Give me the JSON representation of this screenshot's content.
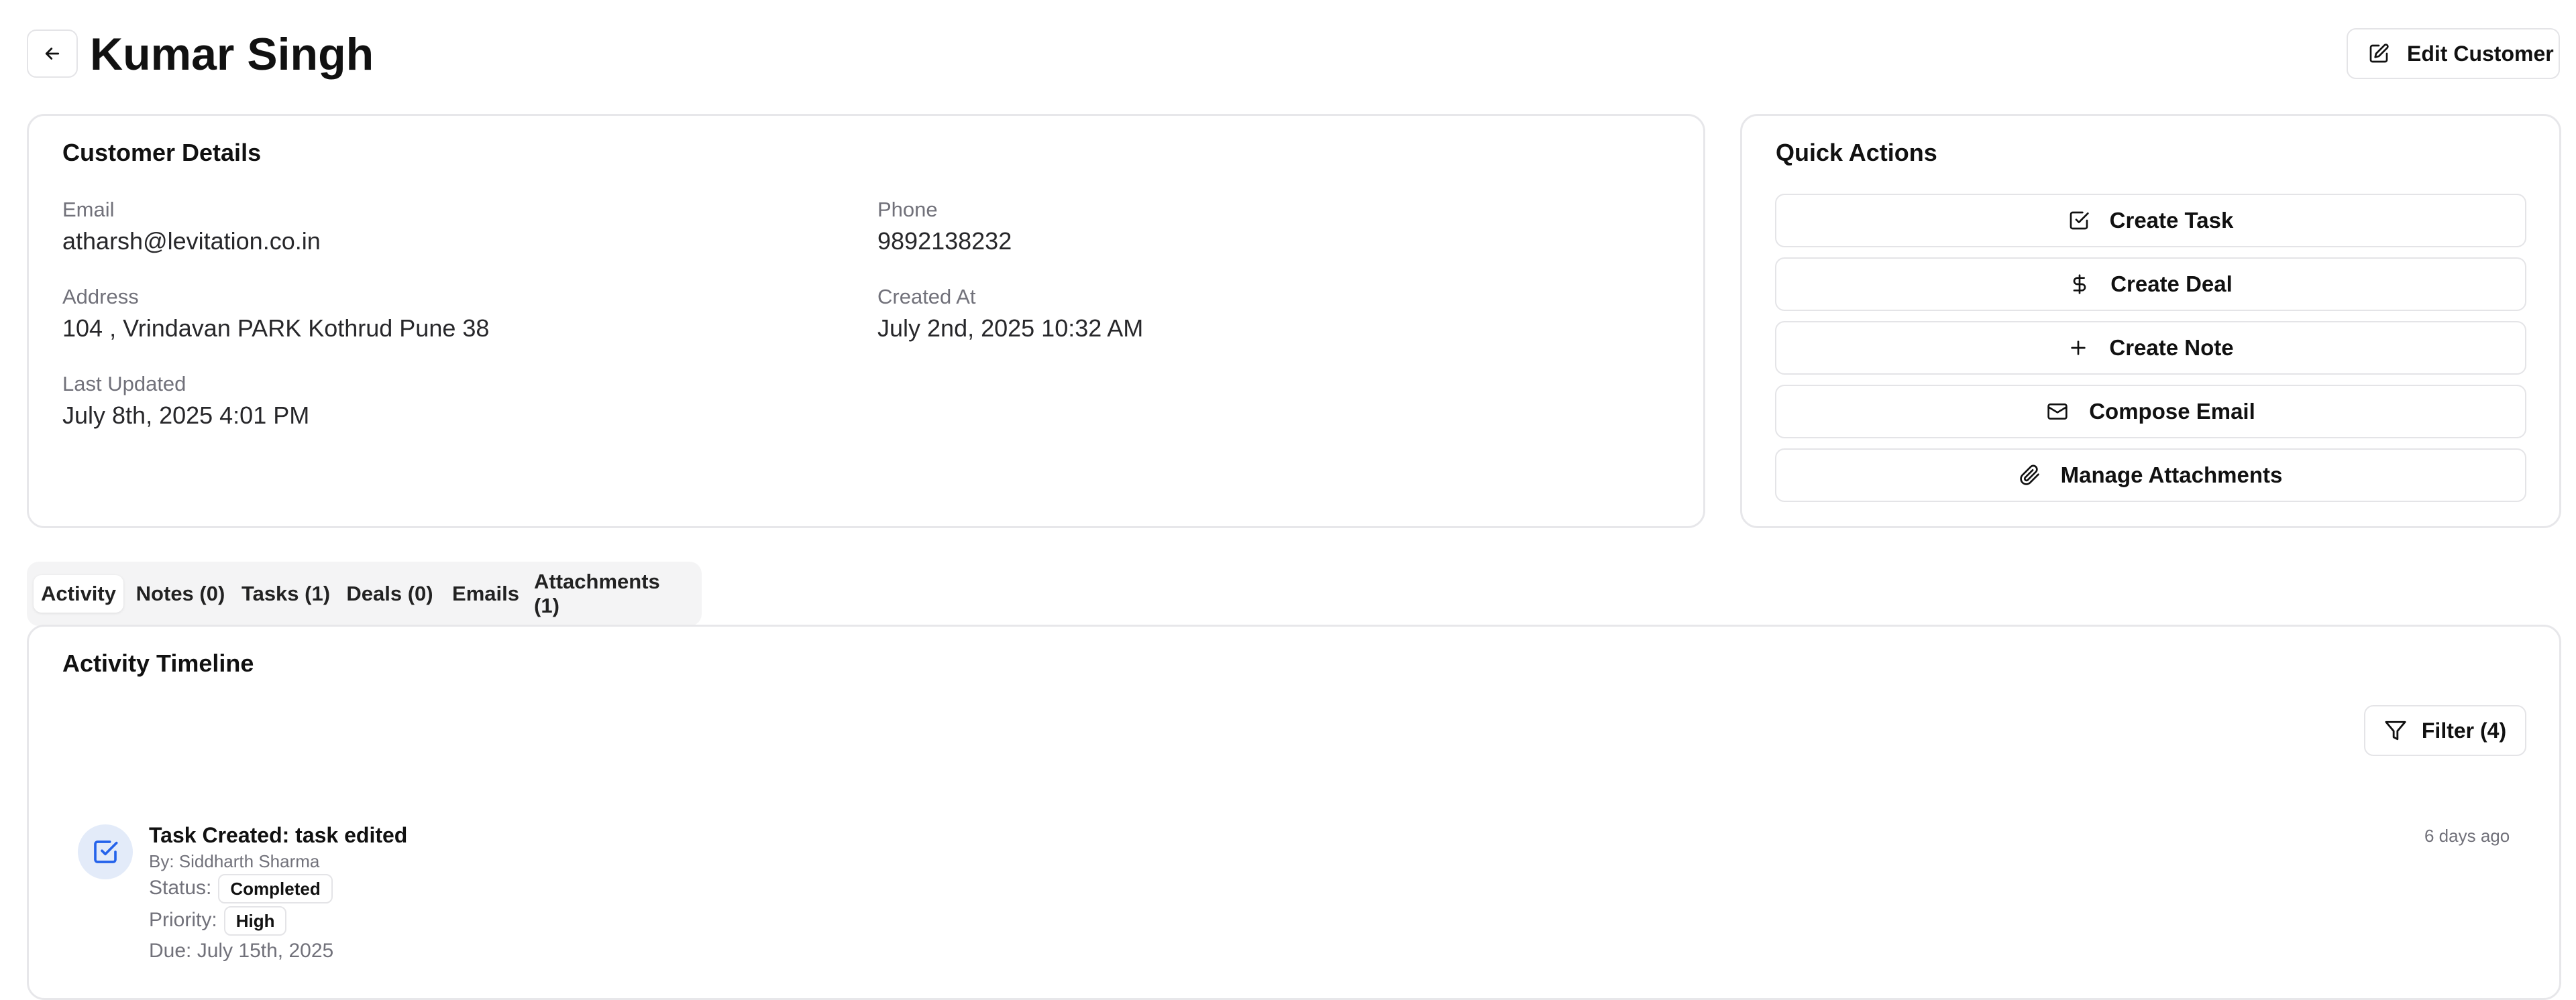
{
  "header": {
    "title": "Kumar Singh",
    "edit_label": "Edit Customer"
  },
  "details": {
    "title": "Customer Details",
    "email_label": "Email",
    "email": "atharsh@levitation.co.in",
    "phone_label": "Phone",
    "phone": "9892138232",
    "address_label": "Address",
    "address": "104 , Vrindavan PARK Kothrud Pune 38",
    "created_label": "Created At",
    "created": "July 2nd, 2025 10:32 AM",
    "updated_label": "Last Updated",
    "updated": "July 8th, 2025 4:01 PM"
  },
  "quick_actions": {
    "title": "Quick Actions",
    "items": [
      {
        "label": "Create Task",
        "icon": "check-square-icon"
      },
      {
        "label": "Create Deal",
        "icon": "dollar-icon"
      },
      {
        "label": "Create Note",
        "icon": "plus-icon"
      },
      {
        "label": "Compose Email",
        "icon": "mail-icon"
      },
      {
        "label": "Manage Attachments",
        "icon": "paperclip-icon"
      }
    ]
  },
  "tabs": [
    {
      "label": "Activity",
      "active": true
    },
    {
      "label": "Notes (0)"
    },
    {
      "label": "Tasks (1)"
    },
    {
      "label": "Deals (0)"
    },
    {
      "label": "Emails"
    },
    {
      "label": "Attachments (1)"
    }
  ],
  "timeline": {
    "title": "Activity Timeline",
    "filter_label": "Filter (4)",
    "items": [
      {
        "title": "Task Created: task edited",
        "by": "By: Siddharth Sharma",
        "status_label": "Status:",
        "status": "Completed",
        "priority_label": "Priority:",
        "priority": "High",
        "due": "Due: July 15th, 2025",
        "time": "6 days ago",
        "icon": "check-square-icon"
      }
    ]
  },
  "colors": {
    "icon_bubble": "#e3ebf9",
    "icon_blue": "#2563eb",
    "border": "#e7e7ea",
    "tabs_bg": "#f4f4f5"
  }
}
